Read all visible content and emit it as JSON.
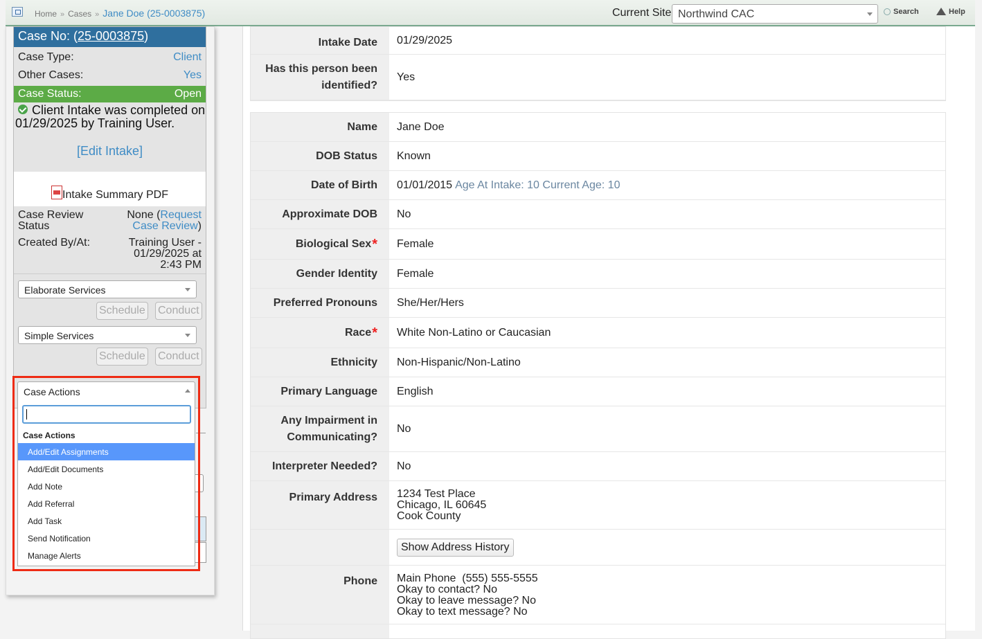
{
  "breadcrumb": {
    "home": "Home",
    "cases": "Cases",
    "current": "Jane Doe (25-0003875)",
    "sep": "»"
  },
  "header": {
    "site_label": "Current Site",
    "site_value": "Northwind CAC",
    "search": "Search",
    "help": "Help"
  },
  "sidebar": {
    "case_no_label": "Case No: (",
    "case_no": "25-0003875",
    "case_no_close": ")",
    "case_type_label": "Case Type:",
    "case_type": "Client",
    "other_cases_label": "Other Cases:",
    "other_cases": "Yes",
    "status_label": "Case Status:",
    "status": "Open",
    "intake_msg": "Client Intake was completed on 01/29/2025 by Training User.",
    "edit_intake": "[Edit Intake]",
    "pdf_label": "Intake Summary PDF",
    "review_label": "Case Review Status",
    "review_none": "None (",
    "review_link": "Request Case Review",
    "review_close": ")",
    "created_label": "Created By/At:",
    "created_value": "Training User - 01/29/2025 at 2:43 PM",
    "elaborate_services": "Elaborate Services",
    "simple_services": "Simple Services",
    "schedule": "Schedule",
    "conduct": "Conduct"
  },
  "case_actions": {
    "label": "Case Actions",
    "search_value": "",
    "group": "Case Actions",
    "items": [
      "Add/Edit Assignments",
      "Add/Edit Documents",
      "Add Note",
      "Add Referral",
      "Add Task",
      "Send Notification",
      "Manage Alerts"
    ],
    "highlighted_index": 0
  },
  "form": {
    "intake_date_label": "Intake Date",
    "intake_date": "01/29/2025",
    "identified_label": "Has this person been identified?",
    "identified": "Yes",
    "name_label": "Name",
    "name": "Jane Doe",
    "dob_status_label": "DOB Status",
    "dob_status": "Known",
    "dob_label": "Date of Birth",
    "dob": "01/01/2015",
    "dob_ages": "Age At Intake: 10 Current Age: 10",
    "approx_dob_label": "Approximate DOB",
    "approx_dob": "No",
    "bio_sex_label": "Biological Sex",
    "bio_sex": "Female",
    "gender_label": "Gender Identity",
    "gender": "Female",
    "pronouns_label": "Preferred Pronouns",
    "pronouns": "She/Her/Hers",
    "race_label": "Race",
    "race": "White Non-Latino or Caucasian",
    "ethnicity_label": "Ethnicity",
    "ethnicity": "Non-Hispanic/Non-Latino",
    "language_label": "Primary Language",
    "language": "English",
    "impairment_label": "Any Impairment in Communicating?",
    "impairment": "No",
    "interpreter_label": "Interpreter Needed?",
    "interpreter": "No",
    "address_label": "Primary Address",
    "address_line1": "1234 Test Place",
    "address_line2": "Chicago, IL 60645",
    "address_line3": "Cook County",
    "address_history_btn": "Show Address History",
    "phone_label": "Phone",
    "phone_line1": "Main Phone  (555) 555-5555",
    "phone_line2": "Okay to contact? No",
    "phone_line3": "Okay to leave message? No",
    "phone_line4": "Okay to text message? No",
    "required_mark": "*"
  },
  "colors": {
    "accent": "#3f8cc5",
    "header_blue": "#2f6f9e",
    "status_green": "#5cab46",
    "highlight_red": "#ee2b14",
    "select_blue": "#5897fb"
  }
}
